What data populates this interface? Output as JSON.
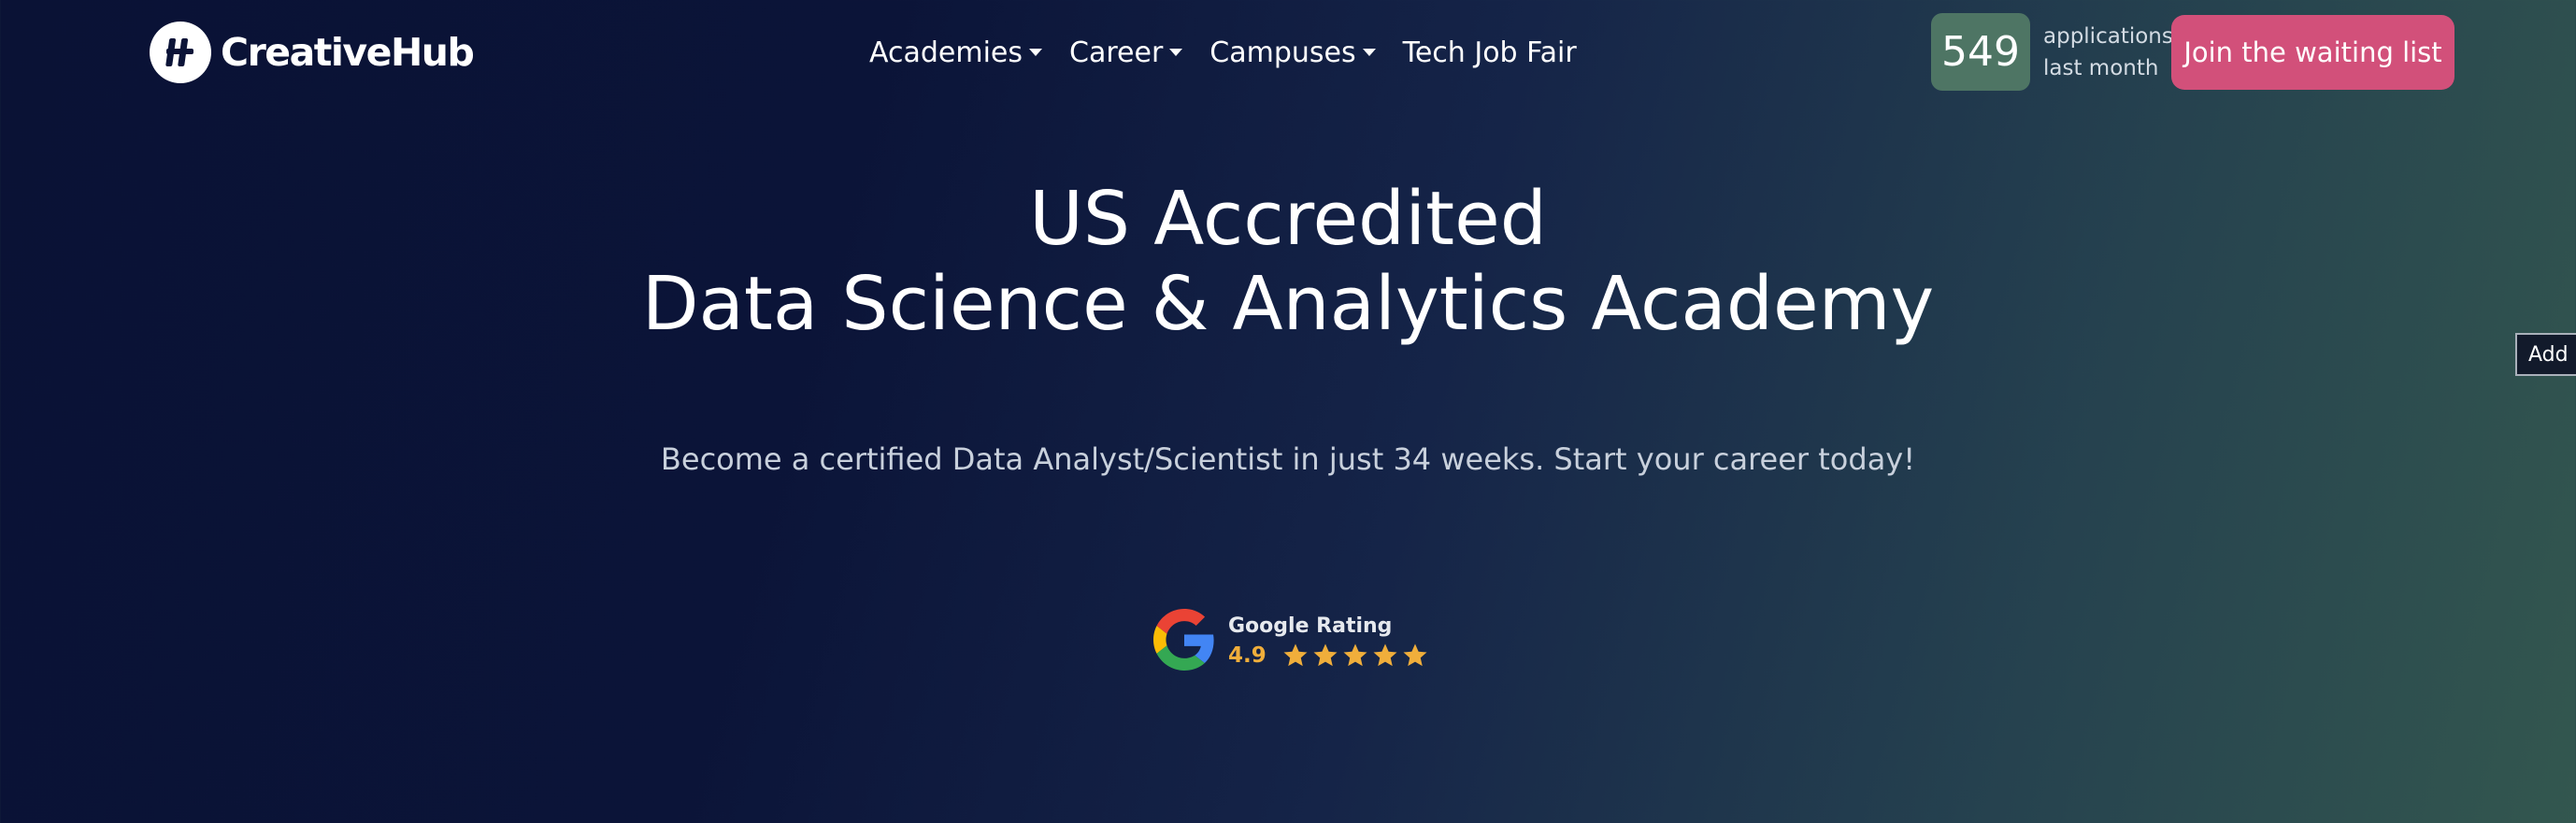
{
  "brand": {
    "name": "CreativeHub",
    "logo_icon": "hashtag-icon"
  },
  "nav": {
    "items": [
      {
        "label": "Academies",
        "has_dropdown": true
      },
      {
        "label": "Career",
        "has_dropdown": true
      },
      {
        "label": "Campuses",
        "has_dropdown": true
      },
      {
        "label": "Tech Job Fair",
        "has_dropdown": false
      }
    ]
  },
  "applications": {
    "count": "549",
    "label_line1": "applications",
    "label_line2": "last month"
  },
  "cta": {
    "label": "Join the waiting list"
  },
  "hero": {
    "title_line1": "US Accredited",
    "title_line2": "Data Science & Analytics Academy",
    "subtitle": "Become a certified Data Analyst/Scientist in just 34 weeks. Start your career today!"
  },
  "rating": {
    "title": "Google Rating",
    "value": "4.9",
    "stars": 5,
    "icon": "google-g-icon"
  },
  "side_tab": {
    "label": "Add"
  },
  "colors": {
    "background_start": "#0a1235",
    "background_end": "#33574f",
    "count_badge": "#4e7564",
    "cta": "#d2507a",
    "rating_accent": "#f0ae3b"
  }
}
